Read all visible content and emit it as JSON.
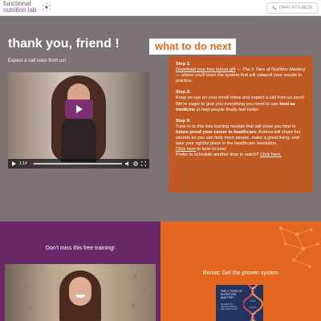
{
  "header": {
    "logo_line1": "functional",
    "logo_line2": "nutrition lab",
    "phone_icon": "phone-icon",
    "phone": "(844) 673-6626"
  },
  "hero": {
    "title": "thank you, friend !",
    "subtitle": "Expect a call soon from us!",
    "video": {
      "time": "1:14",
      "progress": 0.04,
      "play_icon": "play-icon",
      "controls": [
        "volume-icon",
        "settings-icon",
        "fullscreen-icon"
      ]
    }
  },
  "what_to_do_next": {
    "title": "what to do next",
    "step1_label": "Step 1:",
    "step1_link": "Download your free bonus gift",
    "step1_dash": " — ",
    "step1_em": "The 3 Tiers of Nutrition Mastery",
    "step1_rest": " — where you'll learn the system that will catapult your results in practice.",
    "step2_label": "Step 2:",
    "step2_text": "Keep an eye on your email inbox and expect a call from us soon! We're eager to give you everything you need to use ",
    "step2_strong": "food as medicine",
    "step2_em": " to help people finally feel better.",
    "step3_label": "Step 3:",
    "step3_text": "Tune-in to this free training module that will show you how to ",
    "step3_strong": "future-proof your career in healthcare.",
    "step3_rest": " Andrea will share her secrets so you can help more people, make a great living, and take your rightful place in the healthcare revolution.",
    "step3_link": "Click here",
    "step3_link_rest": " to tune-in now!",
    "schedule_text": "Prefer to schedule another time to watch? ",
    "schedule_link": "Click here."
  },
  "training": {
    "heading": "Don't miss this free training!"
  },
  "bonus": {
    "heading": "Bonus: Get the proven system",
    "book_title": "THE 3 TIERS OF NUTRITION MASTERY",
    "book_sub": "SECRETS TO HELPING PEOPLE HEAL WITH FOOD"
  },
  "colors": {
    "hero_bg": "#7b7374",
    "card_bg": "#bf5a24",
    "accent_orange": "#e26b23",
    "purple": "#6b2868",
    "orange": "#e4671f",
    "play_button": "#7d2f72"
  }
}
